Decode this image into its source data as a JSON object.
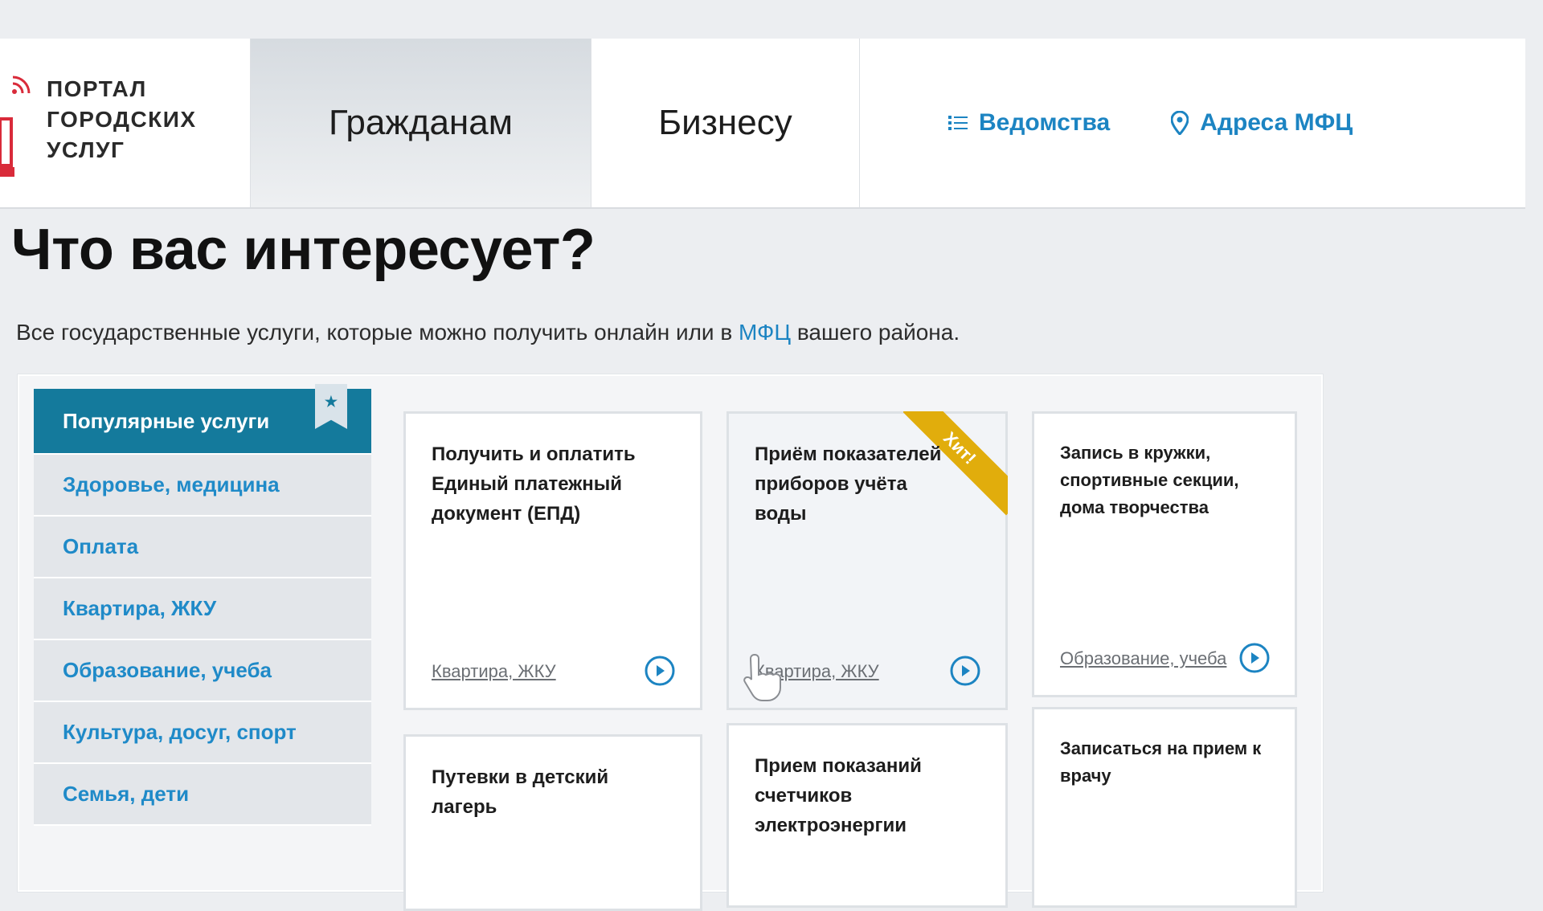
{
  "header": {
    "logo_lines": [
      "ПОРТАЛ",
      "ГОРОДСКИХ",
      "УСЛУГ"
    ],
    "tabs": [
      {
        "label": "Гражданам",
        "active": true
      },
      {
        "label": "Бизнесу",
        "active": false
      }
    ],
    "links": [
      {
        "label": "Ведомства",
        "icon": "list-icon"
      },
      {
        "label": "Адреса МФЦ",
        "icon": "map-pin-icon"
      }
    ]
  },
  "page": {
    "title": "Что вас интересует?",
    "subtitle_before": "Все государственные услуги,  которые можно получить онлайн или в",
    "subtitle_link": "МФЦ",
    "subtitle_after": "вашего района."
  },
  "sidebar": {
    "items": [
      {
        "label": "Популярные услуги",
        "active": true
      },
      {
        "label": "Здоровье, медицина"
      },
      {
        "label": "Оплата"
      },
      {
        "label": "Квартира, ЖКУ"
      },
      {
        "label": "Образование, учеба"
      },
      {
        "label": "Культура, досуг, спорт"
      },
      {
        "label": "Семья, дети"
      }
    ],
    "bookmark_icon": "star-icon"
  },
  "cards": [
    {
      "title": "Получить и оплатить Единый платежный документ (ЕПД)",
      "category": "Квартира, ЖКУ"
    },
    {
      "title": "Приём показателей приборов учёта воды",
      "category": "Квартира, ЖКУ",
      "badge": "Хит!"
    },
    {
      "title": "Запись в кружки, спортивные секции, дома творчества",
      "category": "Образование, учеба"
    },
    {
      "title": "Путевки в детский лагерь"
    },
    {
      "title": "Прием показаний счетчиков электроэнергии"
    },
    {
      "title": "Записаться на прием к врачу"
    }
  ],
  "colors": {
    "accent": "#1c84c2",
    "sidebar_active": "#147a9c",
    "badge": "#e1ad0c"
  }
}
